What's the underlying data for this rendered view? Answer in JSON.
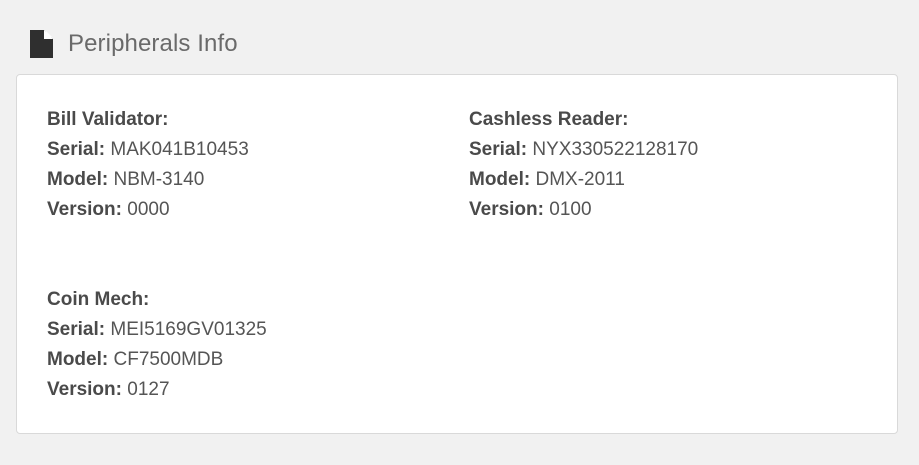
{
  "header": {
    "title": "Peripherals Info",
    "icon": "file-icon"
  },
  "devices": [
    {
      "name": "Bill Validator:",
      "serial_label": "Serial:",
      "serial": "MAK041B10453",
      "model_label": "Model:",
      "model": "NBM-3140",
      "version_label": "Version:",
      "version": "0000"
    },
    {
      "name": "Cashless Reader:",
      "serial_label": "Serial:",
      "serial": "NYX330522128170",
      "model_label": "Model:",
      "model": "DMX-2011",
      "version_label": "Version:",
      "version": "0100"
    },
    {
      "name": "Coin Mech:",
      "serial_label": "Serial:",
      "serial": "MEI5169GV01325",
      "model_label": "Model:",
      "model": "CF7500MDB",
      "version_label": "Version:",
      "version": "0127"
    }
  ]
}
